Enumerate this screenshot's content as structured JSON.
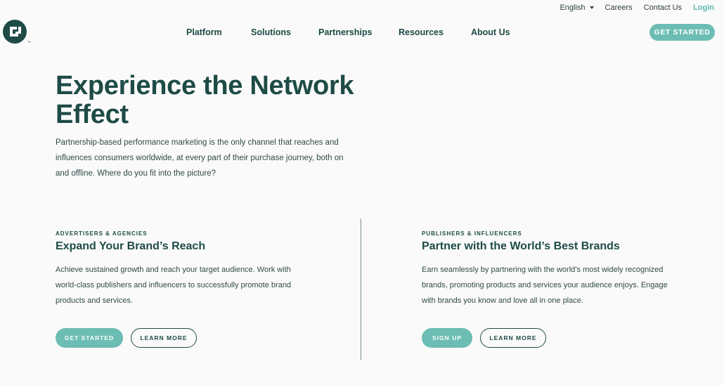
{
  "utility": {
    "language": "English",
    "careers": "Careers",
    "contact": "Contact Us",
    "login": "Login"
  },
  "nav": {
    "items": [
      "Platform",
      "Solutions",
      "Partnerships",
      "Resources",
      "About Us"
    ],
    "cta": "GET STARTED"
  },
  "hero": {
    "title": "Experience the Network Effect",
    "description": "Partnership-based performance marketing is the only channel that reaches and influences consumers worldwide, at every part of their purchase journey, both on and offline. Where do you fit into the picture?"
  },
  "advertisers": {
    "eyebrow": "ADVERTISERS & AGENCIES",
    "title": "Expand Your Brand’s Reach",
    "description": "Achieve sustained growth and reach your target audience. Work with world-class publishers and influencers to successfully promote brand products and services.",
    "primary": "GET STARTED",
    "secondary": "LEARN MORE"
  },
  "publishers": {
    "eyebrow": "PUBLISHERS & INFLUENCERS",
    "title": "Partner with the World’s Best Brands",
    "description": "Earn seamlessly by partnering with the world’s most widely recognized brands, promoting products and services your audience enjoys. Engage with brands you know and love all in one place.",
    "primary": "SIGN UP",
    "secondary": "LEARN MORE"
  },
  "colors": {
    "brand_dark": "#1e4b46",
    "accent": "#6cbdb3",
    "background": "#fafafa"
  },
  "icons": {
    "logo": "cj-logo-icon",
    "language_caret": "caret-down-icon"
  }
}
